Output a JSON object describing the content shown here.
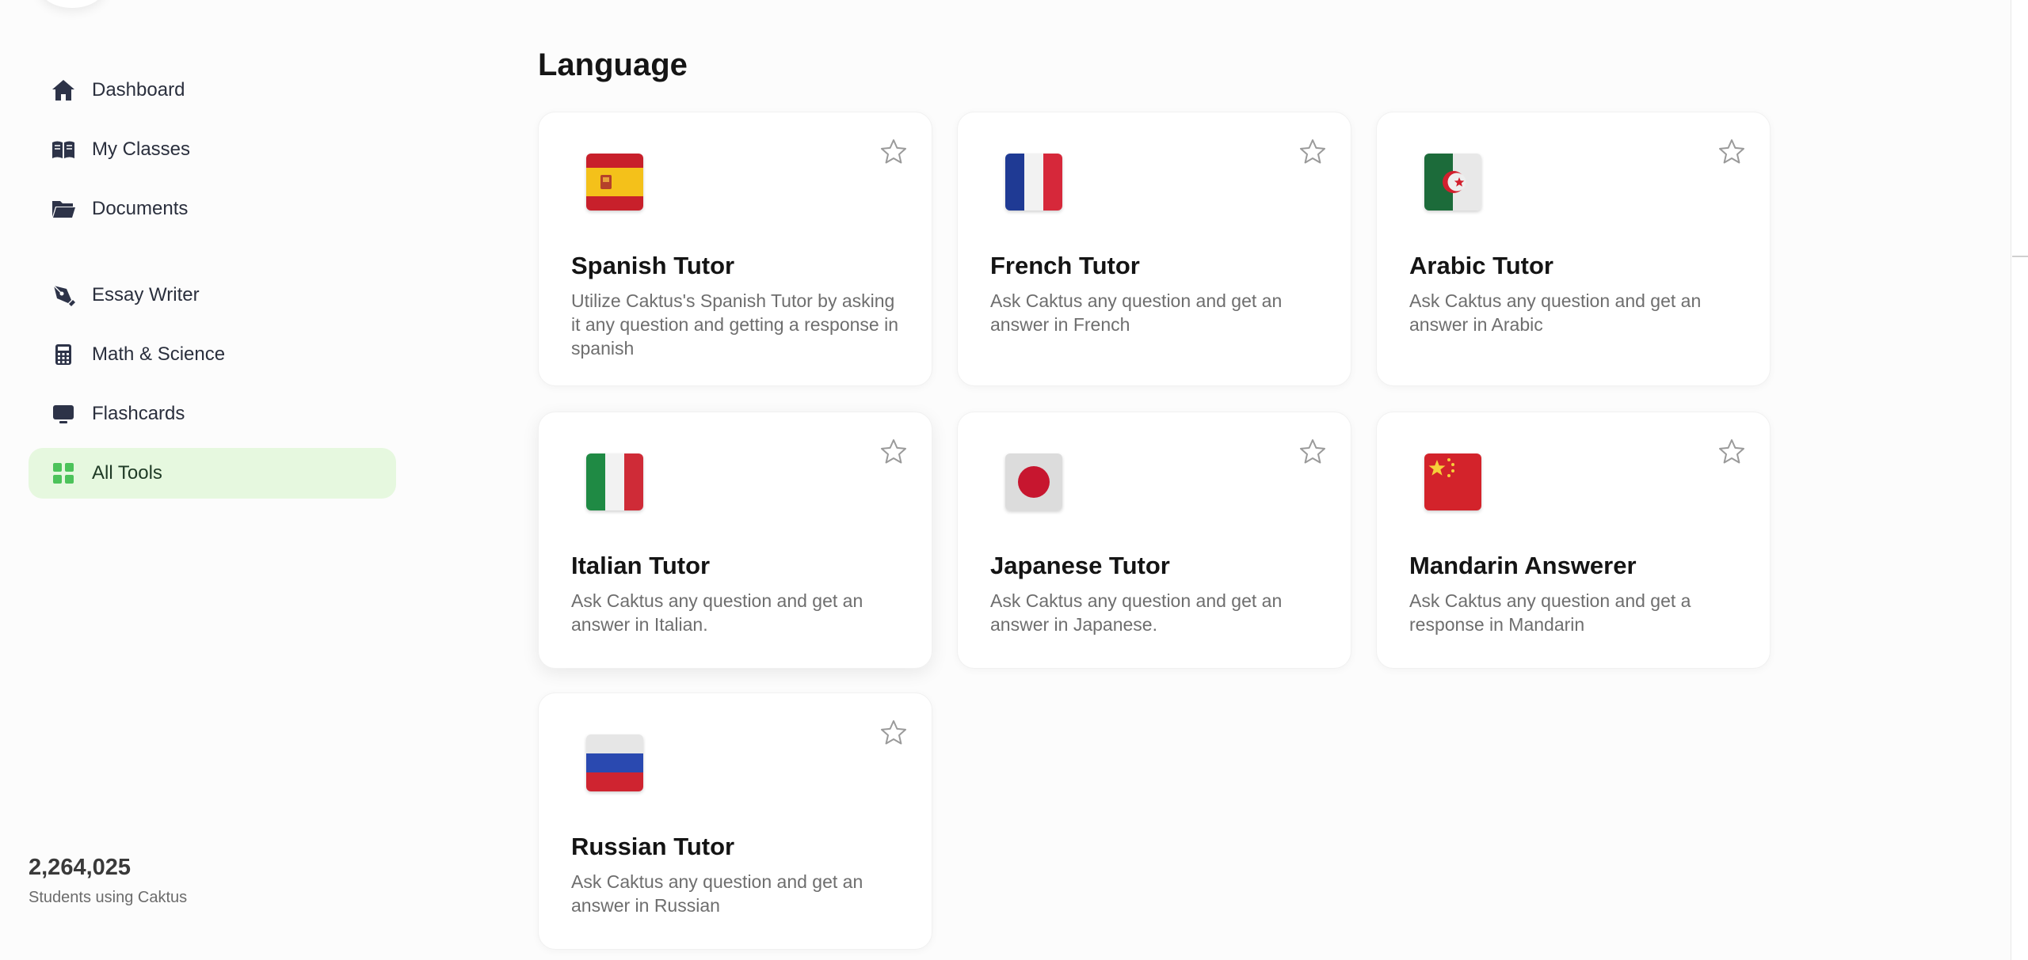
{
  "sidebar": {
    "items": [
      {
        "label": "Dashboard",
        "icon": "home-icon"
      },
      {
        "label": "My Classes",
        "icon": "book-icon"
      },
      {
        "label": "Documents",
        "icon": "folder-icon"
      },
      {
        "label": "Essay Writer",
        "icon": "pen-icon"
      },
      {
        "label": "Math & Science",
        "icon": "calculator-icon"
      },
      {
        "label": "Flashcards",
        "icon": "monitor-icon"
      },
      {
        "label": "All Tools",
        "icon": "grid-icon",
        "active": true
      }
    ],
    "stats": {
      "count": "2,264,025",
      "caption": "Students using Caktus"
    }
  },
  "main": {
    "section_title": "Language",
    "cards": [
      {
        "title": "Spanish Tutor",
        "description": "Utilize Caktus's Spanish Tutor by asking it any question and getting a response in spanish",
        "flag": "spain-flag-icon"
      },
      {
        "title": "French Tutor",
        "description": "Ask Caktus any question and get an answer in French",
        "flag": "france-flag-icon"
      },
      {
        "title": "Arabic Tutor",
        "description": "Ask Caktus any question and get an answer in Arabic",
        "flag": "algeria-flag-icon"
      },
      {
        "title": "Italian Tutor",
        "description": "Ask Caktus any question and get an answer in Italian.",
        "flag": "italy-flag-icon"
      },
      {
        "title": "Japanese Tutor",
        "description": "Ask Caktus any question and get an answer in Japanese.",
        "flag": "japan-flag-icon"
      },
      {
        "title": "Mandarin Answerer",
        "description": "Ask Caktus any question and get a response in Mandarin",
        "flag": "china-flag-icon"
      },
      {
        "title": "Russian Tutor",
        "description": "Ask Caktus any question and get an answer in Russian",
        "flag": "russia-flag-icon"
      }
    ]
  },
  "colors": {
    "active_nav_bg": "#e6f8df",
    "active_icon": "#4cc35a",
    "icon_dark": "#2d3348"
  }
}
